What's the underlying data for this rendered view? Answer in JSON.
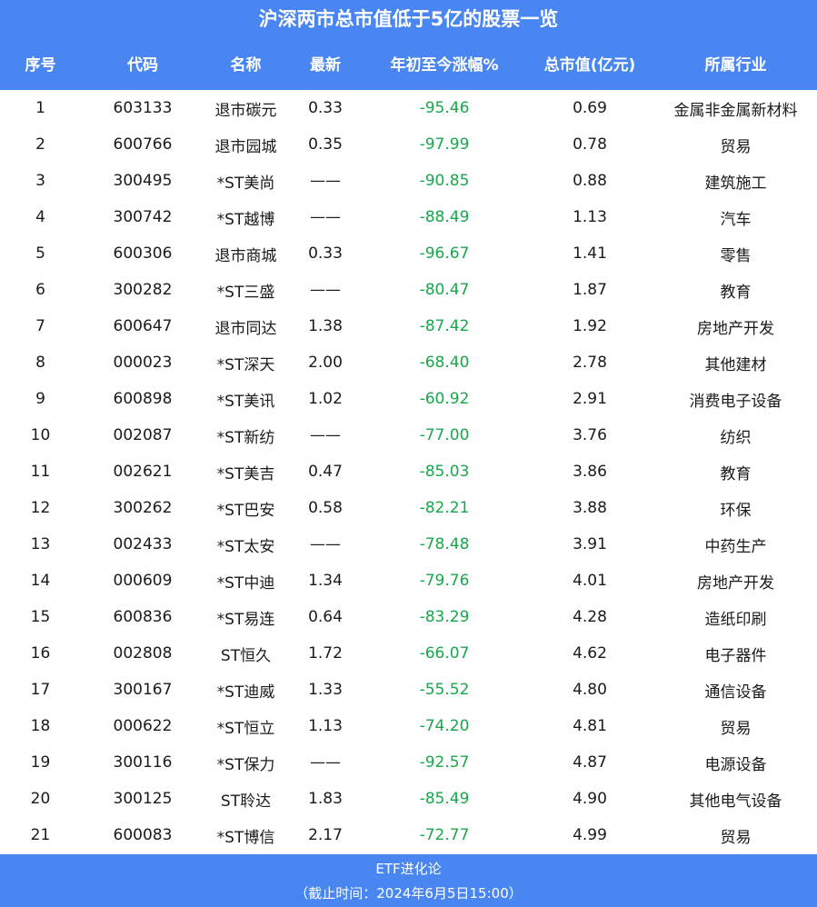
{
  "title": "沪深两市总市值低于5亿的股票一览",
  "headers": [
    "序号",
    "代码",
    "名称",
    "最新",
    "年初至今涨幅%",
    "总市值(亿元)",
    "所属行业"
  ],
  "rows": [
    [
      "1",
      "603133",
      "退市碳元",
      "0.33",
      "-95.46",
      "0.69",
      "金属非金属新材料"
    ],
    [
      "2",
      "600766",
      "退市园城",
      "0.35",
      "-97.99",
      "0.78",
      "贸易"
    ],
    [
      "3",
      "300495",
      "*ST美尚",
      "——",
      "-90.85",
      "0.88",
      "建筑施工"
    ],
    [
      "4",
      "300742",
      "*ST越博",
      "——",
      "-88.49",
      "1.13",
      "汽车"
    ],
    [
      "5",
      "600306",
      "退市商城",
      "0.33",
      "-96.67",
      "1.41",
      "零售"
    ],
    [
      "6",
      "300282",
      "*ST三盛",
      "——",
      "-80.47",
      "1.87",
      "教育"
    ],
    [
      "7",
      "600647",
      "退市同达",
      "1.38",
      "-87.42",
      "1.92",
      "房地产开发"
    ],
    [
      "8",
      "000023",
      "*ST深天",
      "2.00",
      "-68.40",
      "2.78",
      "其他建材"
    ],
    [
      "9",
      "600898",
      "*ST美讯",
      "1.02",
      "-60.92",
      "2.91",
      "消费电子设备"
    ],
    [
      "10",
      "002087",
      "*ST新纺",
      "——",
      "-77.00",
      "3.76",
      "纺织"
    ],
    [
      "11",
      "002621",
      "*ST美吉",
      "0.47",
      "-85.03",
      "3.86",
      "教育"
    ],
    [
      "12",
      "300262",
      "*ST巴安",
      "0.58",
      "-82.21",
      "3.88",
      "环保"
    ],
    [
      "13",
      "002433",
      "*ST太安",
      "——",
      "-78.48",
      "3.91",
      "中药生产"
    ],
    [
      "14",
      "000609",
      "*ST中迪",
      "1.34",
      "-79.76",
      "4.01",
      "房地产开发"
    ],
    [
      "15",
      "600836",
      "*ST易连",
      "0.64",
      "-83.29",
      "4.28",
      "造纸印刷"
    ],
    [
      "16",
      "002808",
      "ST恒久",
      "1.72",
      "-66.07",
      "4.62",
      "电子器件"
    ],
    [
      "17",
      "300167",
      "*ST迪威",
      "1.33",
      "-55.52",
      "4.80",
      "通信设备"
    ],
    [
      "18",
      "000622",
      "*ST恒立",
      "1.13",
      "-74.20",
      "4.81",
      "贸易"
    ],
    [
      "19",
      "300116",
      "*ST保力",
      "——",
      "-92.57",
      "4.87",
      "电源设备"
    ],
    [
      "20",
      "300125",
      "ST聆达",
      "1.83",
      "-85.49",
      "4.90",
      "其他电气设备"
    ],
    [
      "21",
      "600083",
      "*ST博信",
      "2.17",
      "-72.77",
      "4.99",
      "贸易"
    ]
  ],
  "footer": {
    "source": "ETF进化论",
    "timestamp": "（截止时间：2024年6月5日15:00）"
  },
  "colors": {
    "header_bg": "#4a86f2",
    "negative_change": "#18a84b"
  }
}
